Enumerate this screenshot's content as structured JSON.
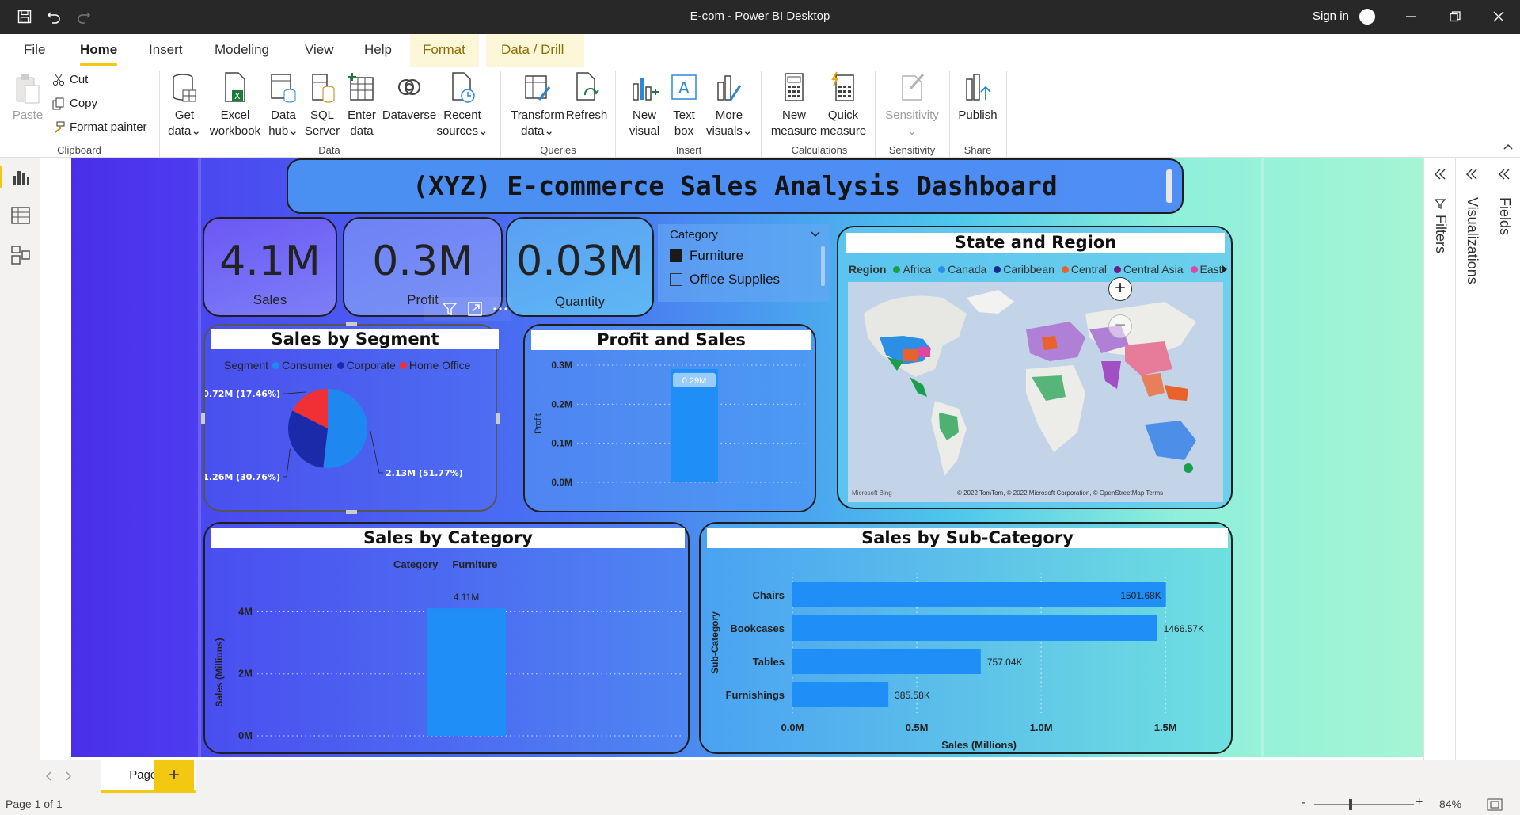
{
  "window": {
    "title": "E-com - Power BI Desktop",
    "sign_in": "Sign in"
  },
  "menu": {
    "tabs": [
      "File",
      "Home",
      "Insert",
      "Modeling",
      "View",
      "Help",
      "Format",
      "Data / Drill"
    ],
    "active": "Home"
  },
  "ribbon": {
    "clipboard": {
      "paste": "Paste",
      "cut": "Cut",
      "copy": "Copy",
      "format_painter": "Format painter",
      "group": "Clipboard"
    },
    "data": {
      "get_data": [
        "Get",
        "data"
      ],
      "excel": [
        "Excel",
        "workbook"
      ],
      "data_hub": [
        "Data",
        "hub"
      ],
      "sql": [
        "SQL",
        "Server"
      ],
      "enter": [
        "Enter",
        "data"
      ],
      "dataverse": "Dataverse",
      "recent": [
        "Recent",
        "sources"
      ],
      "group": "Data"
    },
    "queries": {
      "transform": [
        "Transform",
        "data"
      ],
      "refresh": "Refresh",
      "group": "Queries"
    },
    "insert": {
      "new_visual": [
        "New",
        "visual"
      ],
      "text_box": [
        "Text",
        "box"
      ],
      "more_visuals": [
        "More",
        "visuals"
      ],
      "group": "Insert"
    },
    "calculations": {
      "new_measure": [
        "New",
        "measure"
      ],
      "quick_measure": [
        "Quick",
        "measure"
      ],
      "group": "Calculations"
    },
    "sensitivity": {
      "label": "Sensitivity",
      "group": "Sensitivity"
    },
    "share": {
      "publish": "Publish",
      "group": "Share"
    }
  },
  "dashboard": {
    "title": "(XYZ) E-commerce Sales Analysis Dashboard",
    "kpis": [
      {
        "value": "4.1M",
        "label": "Sales"
      },
      {
        "value": "0.3M",
        "label": "Profit"
      },
      {
        "value": "0.03M",
        "label": "Quantity"
      }
    ],
    "slicer": {
      "title": "Category",
      "items": [
        {
          "label": "Furniture",
          "checked": true
        },
        {
          "label": "Office Supplies",
          "checked": false
        }
      ]
    },
    "map": {
      "title": "State and Region",
      "legend_title": "Region",
      "legend": [
        {
          "name": "Africa",
          "color": "#1a9e4b"
        },
        {
          "name": "Canada",
          "color": "#2b8fe6"
        },
        {
          "name": "Caribbean",
          "color": "#1c2a8f"
        },
        {
          "name": "Central",
          "color": "#e8622c"
        },
        {
          "name": "Central Asia",
          "color": "#6b1f7f"
        },
        {
          "name": "East",
          "color": "#e0479e"
        }
      ],
      "credit": "© 2022 TomTom, © 2022 Microsoft Corporation, © OpenStreetMap  Terms",
      "bing": "Microsoft Bing"
    }
  },
  "chart_data": [
    {
      "type": "pie",
      "title": "Sales by Segment",
      "legend_title": "Segment",
      "categories": [
        "Consumer",
        "Corporate",
        "Home Office"
      ],
      "values": [
        2.13,
        1.26,
        0.72
      ],
      "labels": [
        "2.13M (51.77%)",
        "1.26M (30.76%)",
        "0.72M (17.46%)"
      ],
      "colors": [
        "#1e88f0",
        "#1a2aa8",
        "#ef3136"
      ]
    },
    {
      "type": "bar",
      "title": "Profit and Sales",
      "ylabel": "Profit",
      "categories": [
        ""
      ],
      "values": [
        0.29
      ],
      "data_labels": [
        "0.29M"
      ],
      "yticks": [
        "0.0M",
        "0.1M",
        "0.2M",
        "0.3M"
      ],
      "ylim": [
        0,
        0.3
      ]
    },
    {
      "type": "bar",
      "title": "Sales by Category",
      "legend_title": "Category",
      "series": [
        {
          "name": "Furniture",
          "values": [
            4.11
          ]
        }
      ],
      "data_labels": [
        "4.11M"
      ],
      "ylabel": "Sales (Millions)",
      "yticks": [
        "0M",
        "2M",
        "4M"
      ],
      "ylim": [
        0,
        4.6
      ]
    },
    {
      "type": "bar",
      "title": "Sales by Sub-Category",
      "orientation": "horizontal",
      "categories": [
        "Chairs",
        "Bookcases",
        "Tables",
        "Furnishings"
      ],
      "values": [
        1501.68,
        1466.57,
        757.04,
        385.58
      ],
      "data_labels": [
        "1501.68K",
        "1466.57K",
        "757.04K",
        "385.58K"
      ],
      "xlabel": "Sales (Millions)",
      "ylabel": "Sub-Category",
      "xticks": [
        "0.0M",
        "0.5M",
        "1.0M",
        "1.5M"
      ],
      "xlim": [
        0,
        1700
      ]
    }
  ],
  "panes": {
    "filters": "Filters",
    "visualizations": "Visualizations",
    "fields": "Fields"
  },
  "pages": {
    "tabs": [
      "Page 1"
    ],
    "add": "+"
  },
  "status": {
    "page": "Page 1 of 1",
    "zoom": "84%"
  }
}
